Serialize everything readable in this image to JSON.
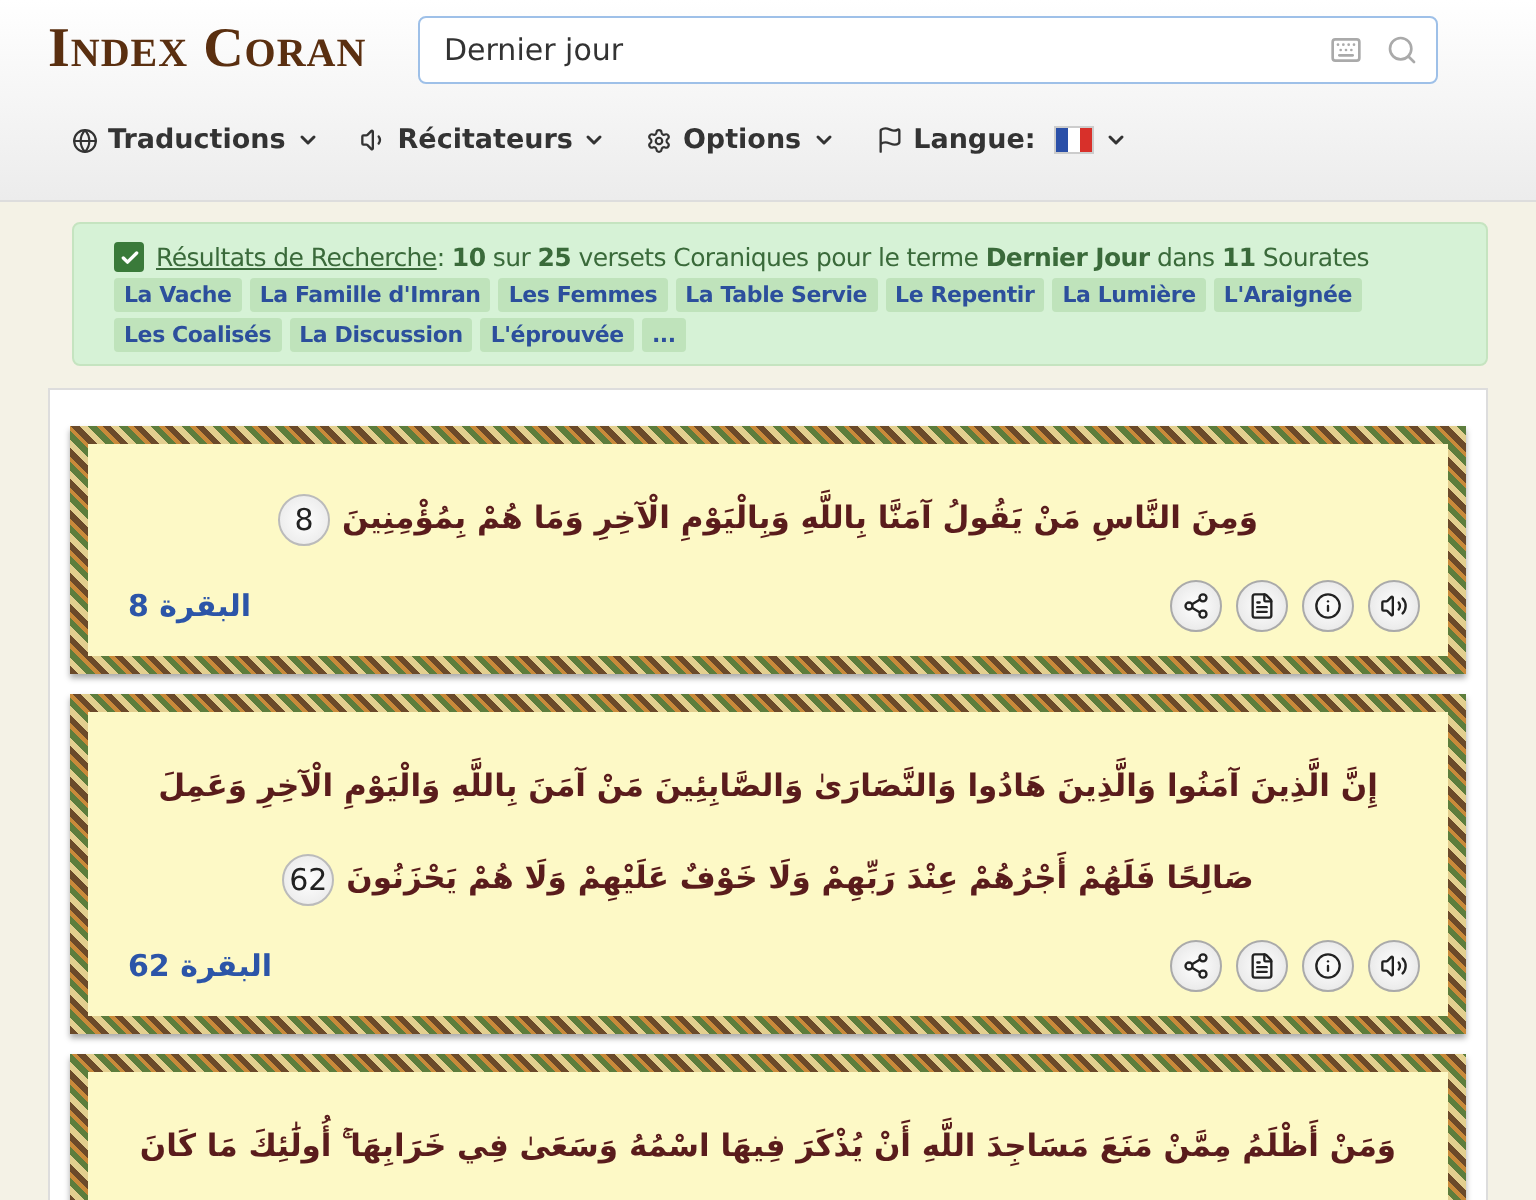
{
  "header": {
    "logo": "Index Coran",
    "search": {
      "value": "Dernier jour"
    }
  },
  "nav": [
    {
      "kind": "translations",
      "label": "Traductions"
    },
    {
      "kind": "reciters",
      "label": "Récitateurs"
    },
    {
      "kind": "options",
      "label": "Options"
    },
    {
      "kind": "language",
      "label": "Langue:"
    }
  ],
  "results": {
    "checked": true,
    "link": "Résultats de Recherche",
    "summary": ": **10** sur **25** versets Coraniques pour le terme **Dernier Jour** dans **11** Sourates",
    "tags": [
      "La Vache",
      "La Famille d'Imran",
      "Les Femmes",
      "La Table Servie",
      "Le Repentir",
      "La Lumière",
      "L'Araignée",
      "Les Coalisés",
      "La Discussion",
      "L'éprouvée",
      "..."
    ]
  },
  "verses": [
    {
      "lines": [
        "وَمِنَ النَّاسِ مَنْ يَقُولُ آمَنَّا بِاللَّهِ وَبِالْيَوْمِ الْآخِرِ وَمَا هُمْ بِمُؤْمِنِينَ"
      ],
      "number": "8",
      "reference": "البقرة 8"
    },
    {
      "lines": [
        "إِنَّ الَّذِينَ آمَنُوا وَالَّذِينَ هَادُوا وَالنَّصَارَىٰ وَالصَّابِئِينَ مَنْ آمَنَ بِاللَّهِ وَالْيَوْمِ الْآخِرِ وَعَمِلَ",
        "صَالِحًا فَلَهُمْ أَجْرُهُمْ عِنْدَ رَبِّهِمْ وَلَا خَوْفٌ عَلَيْهِمْ وَلَا هُمْ يَحْزَنُونَ"
      ],
      "number": "62",
      "reference": "البقرة 62"
    },
    {
      "lines": [
        "وَمَنْ أَظْلَمُ مِمَّنْ مَنَعَ مَسَاجِدَ اللَّهِ أَنْ يُذْكَرَ فِيهَا اسْمُهُ وَسَعَىٰ فِي خَرَابِهَا ۚ أُولَٰئِكَ مَا كَانَ"
      ]
    }
  ]
}
